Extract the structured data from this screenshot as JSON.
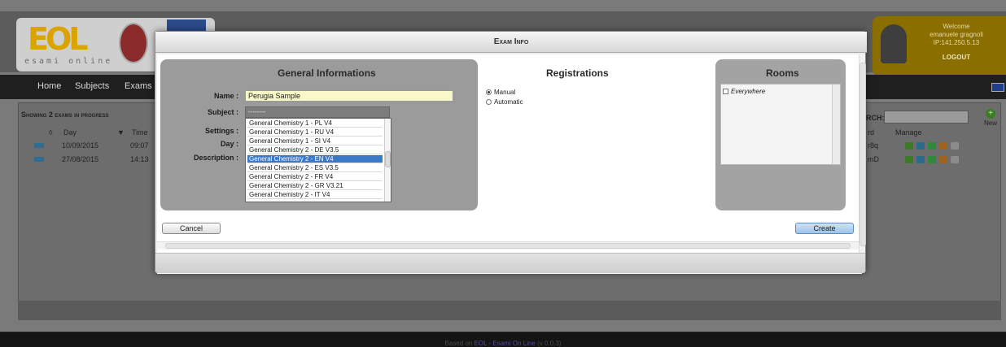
{
  "header": {
    "logo_letters": "EOL",
    "logo_subtitle": "esami online",
    "welcome": {
      "greeting": "Welcome",
      "user": "emanuele gragnoli",
      "ip": "IP:141.250.5.13",
      "logout_label": "LOGOUT"
    }
  },
  "nav": {
    "items": [
      {
        "label": "Home"
      },
      {
        "label": "Subjects"
      },
      {
        "label": "Exams"
      }
    ],
    "language_icon": "uk-flag-icon"
  },
  "exam_list": {
    "heading": "Showing 2 exams in progress",
    "columns": {
      "day": "Day",
      "time": "Time",
      "password": "rd",
      "manage": "Manage"
    },
    "search_label": "RCH:",
    "search_value": "",
    "new_label": "New",
    "rows": [
      {
        "day": "10/09/2015",
        "time": "09:07",
        "password": "r8q"
      },
      {
        "day": "27/08/2015",
        "time": "14:13",
        "password": "mD"
      }
    ]
  },
  "modal": {
    "title": "Exam Info",
    "general": {
      "title": "General Informations",
      "name_label": "Name :",
      "name_value": "Perugia Sample",
      "subject_label": "Subject :",
      "subject_value": "--------",
      "settings_label": "Settings :",
      "day_label": "Day :",
      "description_label": "Description :",
      "subject_options": [
        {
          "label": "General Chemistry 1 - PL V4",
          "selected": false
        },
        {
          "label": "General Chemistry 1 - RU V4",
          "selected": false
        },
        {
          "label": "General Chemistry 1 - SI V4",
          "selected": false
        },
        {
          "label": "General Chemistry 2 - DE V3.5",
          "selected": false
        },
        {
          "label": "General Chemistry 2 - EN V4",
          "selected": true
        },
        {
          "label": "General Chemistry 2 - ES V3.5",
          "selected": false
        },
        {
          "label": "General Chemistry 2 - FR V4",
          "selected": false
        },
        {
          "label": "General Chemistry 2 - GR V3.21",
          "selected": false
        },
        {
          "label": "General Chemistry 2 - IT V4",
          "selected": false
        }
      ]
    },
    "registrations": {
      "title": "Registrations",
      "options": [
        {
          "label": "Manual",
          "checked": true
        },
        {
          "label": "Automatic",
          "checked": false
        }
      ]
    },
    "rooms": {
      "title": "Rooms",
      "everywhere_label": "Everywhere",
      "everywhere_checked": false
    },
    "cancel_label": "Cancel",
    "create_label": "Create"
  },
  "footer": {
    "prefix": "Based on",
    "link": "EOL - Esami On Line",
    "version": "(v 0.0.3)"
  },
  "colors": {
    "accent_gold": "#d9a400",
    "selection_blue": "#3a78c8",
    "name_input_bg": "#f8f8c8",
    "create_button": "#9cc4ec"
  }
}
